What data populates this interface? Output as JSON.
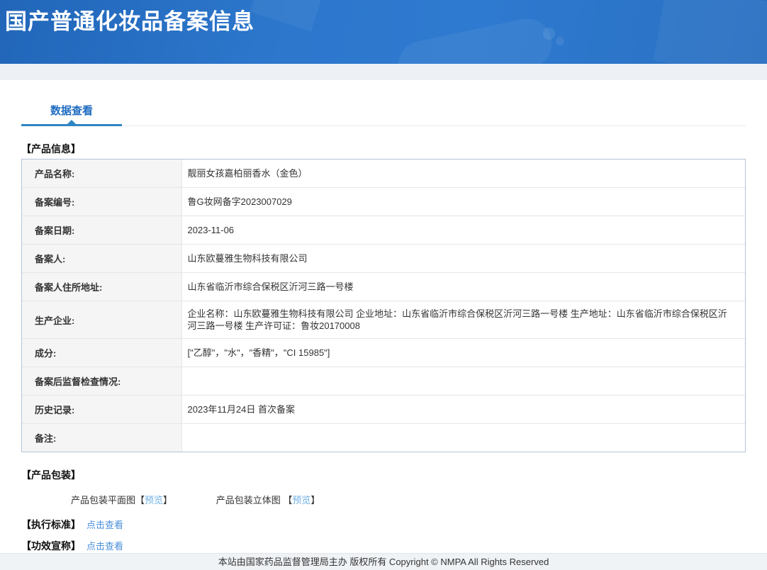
{
  "header": {
    "title": "国产普通化妆品备案信息"
  },
  "tabs": {
    "data_view": {
      "label": "数据查看"
    }
  },
  "product_info": {
    "section_label": "【产品信息】",
    "rows": [
      {
        "label": "产品名称:",
        "value": "靓丽女孩嘉柏丽香水（金色）"
      },
      {
        "label": "备案编号:",
        "value": "鲁G妆网备字2023007029"
      },
      {
        "label": "备案日期:",
        "value": "2023-11-06"
      },
      {
        "label": "备案人:",
        "value": "山东欧蔓雅生物科技有限公司"
      },
      {
        "label": "备案人住所地址:",
        "value": "山东省临沂市综合保税区沂河三路一号楼"
      },
      {
        "label": "生产企业:",
        "value": "企业名称：山东欧蔓雅生物科技有限公司 企业地址：山东省临沂市综合保税区沂河三路一号楼 生产地址：山东省临沂市综合保税区沂河三路一号楼 生产许可证：鲁妆20170008"
      },
      {
        "label": "成分:",
        "value": "[\"乙醇\"，\"水\"，\"香精\"，\"CI 15985\"]"
      },
      {
        "label": "备案后监督检查情况:",
        "value": ""
      },
      {
        "label": "历史记录:",
        "value": "2023年11月24日 首次备案"
      },
      {
        "label": "备注:",
        "value": ""
      }
    ]
  },
  "packaging": {
    "section_label": "【产品包装】",
    "flat_label": "产品包装平面图",
    "stereo_label": "产品包装立体图 ",
    "bracket_open": "【",
    "bracket_close": "】",
    "preview_link": "预览"
  },
  "standards": {
    "label": "【执行标准】",
    "link": "点击查看"
  },
  "claims": {
    "label": "【功效宣称】",
    "link": "点击查看"
  },
  "footer": {
    "text": "本站由国家药品监督管理局主办 版权所有 Copyright © NMPA All Rights Reserved"
  },
  "colors": {
    "header_gradient_start": "#2166b9",
    "header_gradient_end": "#2e7ad0",
    "tab_text": "#1e6cc0",
    "tab_accent": "#2e86c4",
    "table_outer_border": "#b3c5d8",
    "label_cell_bg": "#f5f5f5",
    "preview_link": "#6fb1e8",
    "click_link": "#4a90da",
    "footer_bg": "#f0f3f6"
  }
}
